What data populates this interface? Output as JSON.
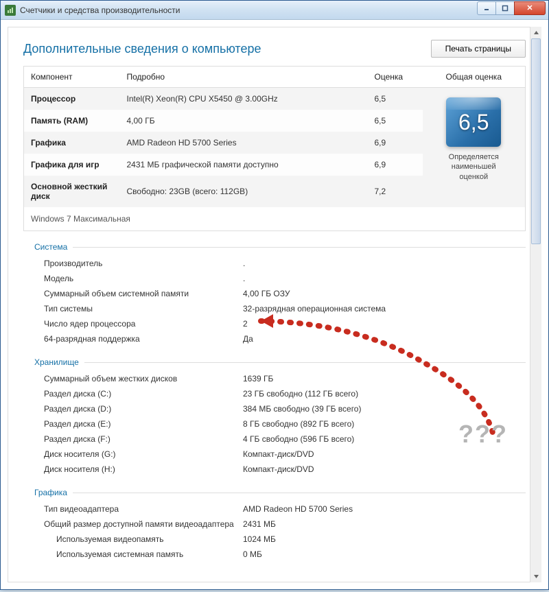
{
  "window": {
    "title": "Счетчики и средства производительности"
  },
  "header": {
    "title": "Дополнительные сведения о компьютере",
    "print": "Печать страницы"
  },
  "table": {
    "headers": {
      "component": "Компонент",
      "detail": "Подробно",
      "subscore": "Оценка",
      "overall": "Общая оценка"
    },
    "rows": [
      {
        "comp": "Процессор",
        "det": "Intel(R) Xeon(R) CPU X5450 @ 3.00GHz",
        "sub": "6,5"
      },
      {
        "comp": "Память (RAM)",
        "det": "4,00 ГБ",
        "sub": "6,5"
      },
      {
        "comp": "Графика",
        "det": "AMD Radeon HD 5700 Series",
        "sub": "6,9"
      },
      {
        "comp": "Графика для игр",
        "det": "2431 МБ графической памяти доступно",
        "sub": "6,9"
      },
      {
        "comp": "Основной жесткий диск",
        "det": "Свободно: 23GB (всего: 112GB)",
        "sub": "7,2"
      }
    ],
    "overall": {
      "score": "6,5",
      "note1": "Определяется",
      "note2": "наименьшей",
      "note3": "оценкой"
    },
    "os": "Windows 7 Максимальная"
  },
  "sections": {
    "system": {
      "title": "Система",
      "rows": [
        {
          "k": "Производитель",
          "v": "."
        },
        {
          "k": "Модель",
          "v": "."
        },
        {
          "k": "Суммарный объем системной памяти",
          "v": "4,00 ГБ ОЗУ"
        },
        {
          "k": "Тип системы",
          "v": "32-разрядная операционная система"
        },
        {
          "k": "Число ядер процессора",
          "v": "2"
        },
        {
          "k": "64-разрядная поддержка",
          "v": "Да"
        }
      ]
    },
    "storage": {
      "title": "Хранилище",
      "rows": [
        {
          "k": "Суммарный объем жестких дисков",
          "v": "1639 ГБ"
        },
        {
          "k": "Раздел диска (C:)",
          "v": "23 ГБ свободно (112 ГБ всего)"
        },
        {
          "k": "Раздел диска (D:)",
          "v": "384 МБ свободно (39 ГБ всего)"
        },
        {
          "k": "Раздел диска (E:)",
          "v": "8 ГБ свободно (892 ГБ всего)"
        },
        {
          "k": "Раздел диска (F:)",
          "v": "4 ГБ свободно (596 ГБ всего)"
        },
        {
          "k": "Диск носителя (G:)",
          "v": "Компакт-диск/DVD"
        },
        {
          "k": "Диск носителя (H:)",
          "v": "Компакт-диск/DVD"
        }
      ]
    },
    "graphics": {
      "title": "Графика",
      "rows": [
        {
          "k": "Тип видеоадаптера",
          "v": "AMD Radeon HD 5700 Series"
        },
        {
          "k": "Общий размер доступной памяти видеоадаптера",
          "v": "2431 МБ"
        },
        {
          "k": "Используемая видеопамять",
          "v": "1024 МБ",
          "indent": true
        },
        {
          "k": "Используемая системная память",
          "v": "0 МБ",
          "indent": true
        }
      ]
    }
  },
  "annotation": {
    "qmarks": "???"
  }
}
